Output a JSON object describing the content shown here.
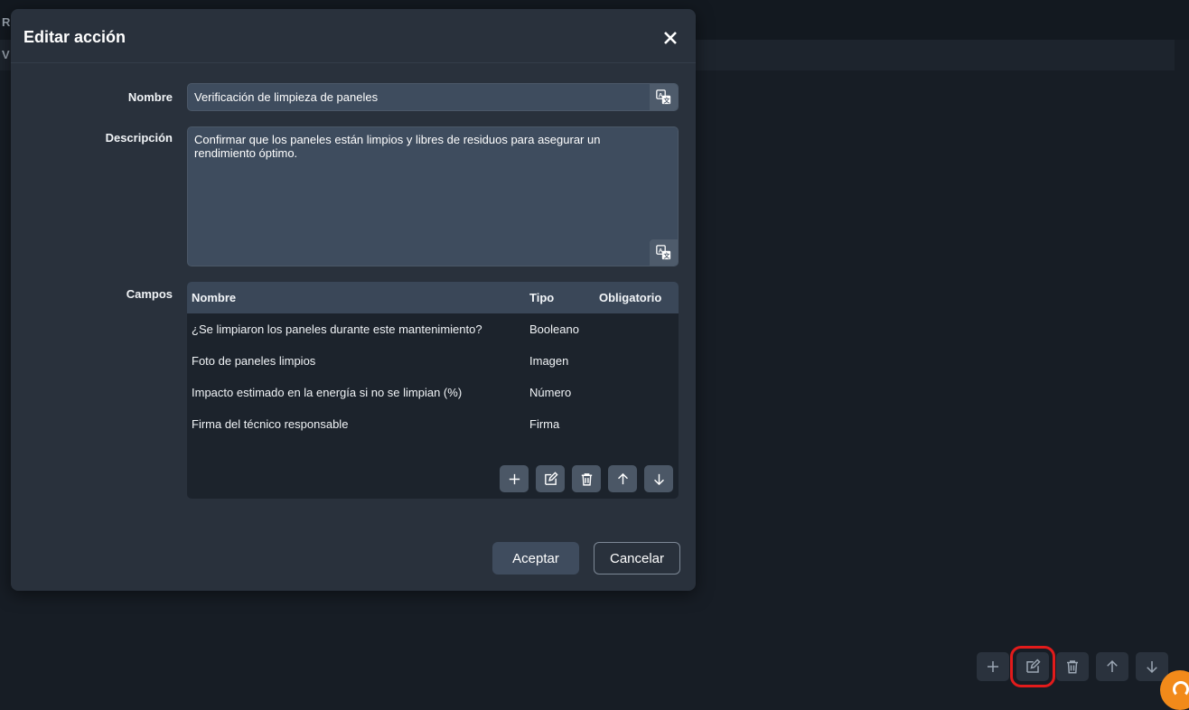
{
  "background": {
    "letters": [
      "R",
      "V"
    ],
    "toolbar": [
      "plus-icon",
      "edit-icon",
      "trash-icon",
      "arrow-up-icon",
      "arrow-down-icon"
    ],
    "highlight_color": "#e21b1b"
  },
  "modal": {
    "title": "Editar acción",
    "name_label": "Nombre",
    "name_value": "Verificación de limpieza de paneles",
    "description_label": "Descripción",
    "description_value": "Confirmar que los paneles están limpios y libres de residuos para asegurar un rendimiento óptimo.",
    "fields_label": "Campos",
    "table": {
      "headers": [
        "Nombre",
        "Tipo",
        "Obligatorio"
      ],
      "rows": [
        {
          "name": "¿Se limpiaron los paneles durante este mantenimiento?",
          "type": "Booleano",
          "required": ""
        },
        {
          "name": "Foto de paneles limpios",
          "type": "Imagen",
          "required": ""
        },
        {
          "name": "Impacto estimado en la energía si no se limpian (%)",
          "type": "Número",
          "required": ""
        },
        {
          "name": "Firma del técnico responsable",
          "type": "Firma",
          "required": ""
        }
      ],
      "tools": [
        "plus-icon",
        "edit-icon",
        "trash-icon",
        "arrow-up-icon",
        "arrow-down-icon"
      ]
    },
    "accept_label": "Aceptar",
    "cancel_label": "Cancelar"
  }
}
